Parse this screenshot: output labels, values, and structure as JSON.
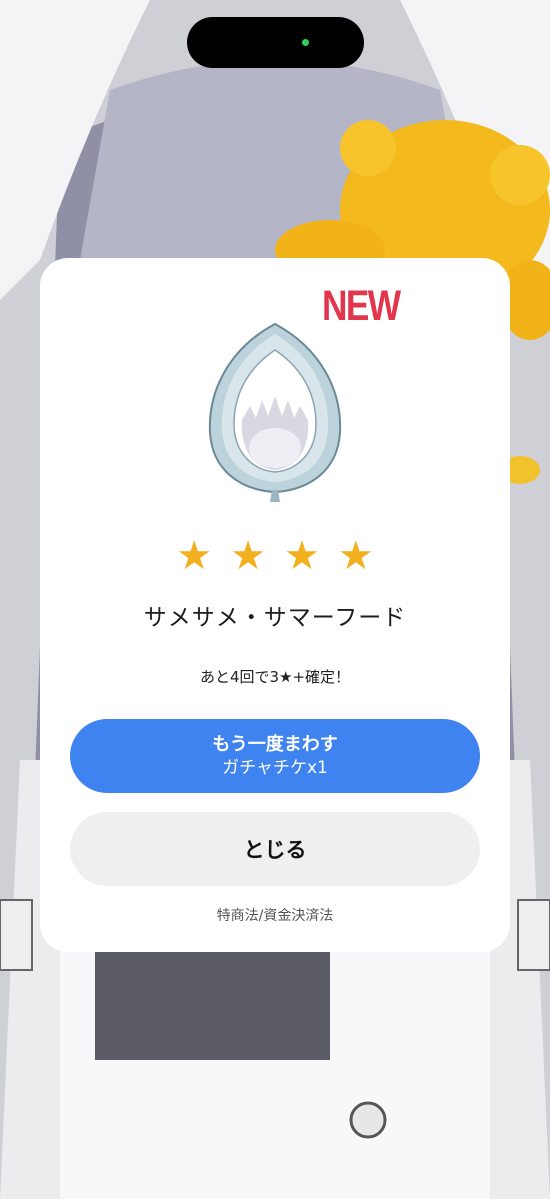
{
  "modal": {
    "badge": "NEW",
    "item_image_icon": "shark-hood-icon",
    "rarity_stars": 4,
    "stars": [
      "★",
      "★",
      "★",
      "★"
    ],
    "item_name": "サメサメ・サマーフード",
    "pity_text": "あと4回で3★+確定！",
    "spin_again_button": {
      "label": "もう一度まわす",
      "cost": "ガチャチケx1"
    },
    "close_button_label": "とじる",
    "legal_link": "特商法/資金決済法"
  },
  "colors": {
    "badge": "#e2364f",
    "star": "#f2b01e",
    "primary_button": "#3e83ef",
    "secondary_button": "#efefef"
  }
}
